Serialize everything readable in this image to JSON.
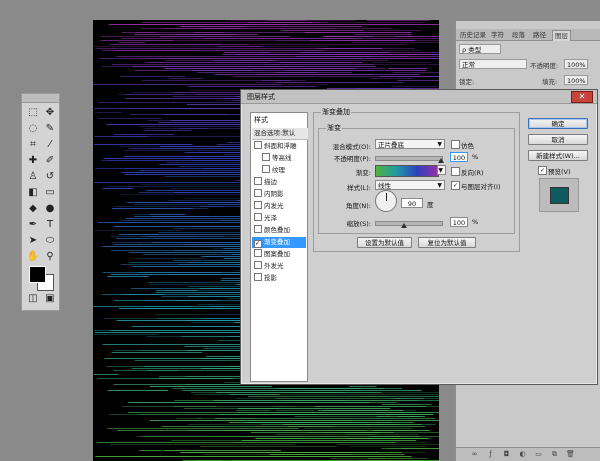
{
  "dialog": {
    "title": "图层样式",
    "close_label": "✕",
    "style_list": {
      "header": "样式",
      "blend_item": "混合选项:默认",
      "items": [
        {
          "label": "斜面和浮雕",
          "checked": false,
          "indent": false
        },
        {
          "label": "等高线",
          "checked": false,
          "indent": true
        },
        {
          "label": "纹理",
          "checked": false,
          "indent": true
        },
        {
          "label": "描边",
          "checked": false,
          "indent": false
        },
        {
          "label": "内阴影",
          "checked": false,
          "indent": false
        },
        {
          "label": "内发光",
          "checked": false,
          "indent": false
        },
        {
          "label": "光泽",
          "checked": false,
          "indent": false
        },
        {
          "label": "颜色叠加",
          "checked": false,
          "indent": false
        },
        {
          "label": "渐变叠加",
          "checked": true,
          "indent": false,
          "selected": true
        },
        {
          "label": "图案叠加",
          "checked": false,
          "indent": false
        },
        {
          "label": "外发光",
          "checked": false,
          "indent": false
        },
        {
          "label": "投影",
          "checked": false,
          "indent": false
        }
      ]
    },
    "gradient_overlay": {
      "section_title": "渐变叠加",
      "group_title": "渐变",
      "blend_mode_label": "混合模式(O):",
      "blend_mode_value": "正片叠底",
      "dither_label": "仿色",
      "opacity_label": "不透明度(P):",
      "opacity_value": "100",
      "percent": "%",
      "gradient_label": "渐变:",
      "reverse_label": "反向(R)",
      "style_label": "样式(L):",
      "style_value": "线性",
      "align_label": "与图层对齐(I)",
      "angle_label": "角度(N):",
      "angle_value": "90",
      "degree": "度",
      "scale_label": "缩放(S):",
      "scale_value": "100",
      "reset_default_button": "设置为默认值",
      "restore_default_button": "复位为默认值"
    },
    "buttons": {
      "ok": "确定",
      "cancel": "取消",
      "new_style": "新建样式(W)...",
      "preview_label": "预览(V)"
    },
    "preview_color": "#0e5a5e"
  },
  "right_panel": {
    "tabs": [
      "历史记录",
      "字符",
      "段落",
      "路径",
      "图层"
    ],
    "active_tab": "图层",
    "filter_label": "ρ 类型",
    "blend_mode": "正常",
    "opacity_label": "不透明度:",
    "opacity_value": "100%",
    "lock_label": "锁定:",
    "fill_label": "填充:",
    "fill_value": "100%",
    "bottom_icons": [
      "link-icon",
      "fx-icon",
      "mask-icon",
      "adjustment-icon",
      "folder-icon",
      "new-layer-icon",
      "trash-icon"
    ]
  },
  "toolbox": {
    "tools": [
      "move-tool-icon",
      "marquee-tool-icon",
      "lasso-tool-icon",
      "quick-select-tool-icon",
      "crop-tool-icon",
      "eyedropper-tool-icon",
      "healing-brush-icon",
      "brush-tool-icon",
      "clone-stamp-icon",
      "history-brush-icon",
      "eraser-tool-icon",
      "gradient-tool-icon",
      "blur-tool-icon",
      "dodge-tool-icon",
      "pen-tool-icon",
      "text-tool-icon",
      "path-select-icon",
      "shape-tool-icon",
      "hand-tool-icon",
      "zoom-tool-icon"
    ],
    "foreground_color": "#000000",
    "background_color": "#ffffff"
  },
  "canvas": {
    "gradient_colors": [
      "#9b2fa8",
      "#2f3fbf",
      "#1f9aa8",
      "#4fb43a"
    ]
  }
}
